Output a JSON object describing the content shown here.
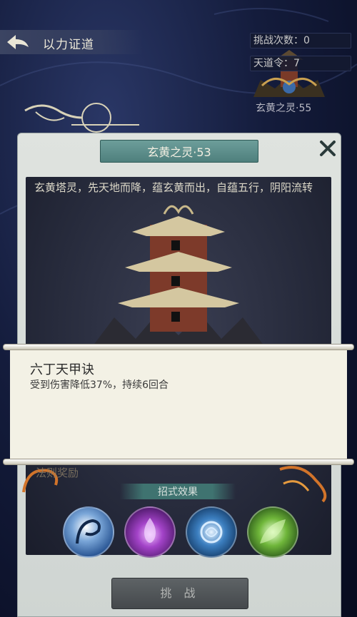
{
  "header": {
    "title": "以力证道",
    "challenge_count": "挑战次数：0",
    "tiandao_token": "天道令：7",
    "next_level": "玄黄之灵·55"
  },
  "panel": {
    "title": "玄黄之灵·53",
    "description": "玄黄塔灵，先天地而降，蕴玄黄而出，自蕴五行，阴阳流转",
    "reward_label": "法则奖励",
    "effect_label": "招式效果",
    "challenge_button": "挑 战"
  },
  "tooltip": {
    "skill_name": "六丁天甲诀",
    "skill_desc": "受到伤害降低37%，持续6回合"
  },
  "skills": [
    {
      "icon": "dragon-skill-icon"
    },
    {
      "icon": "purple-flame-skill-icon"
    },
    {
      "icon": "blue-rune-skill-icon"
    },
    {
      "icon": "green-leaf-skill-icon"
    }
  ]
}
